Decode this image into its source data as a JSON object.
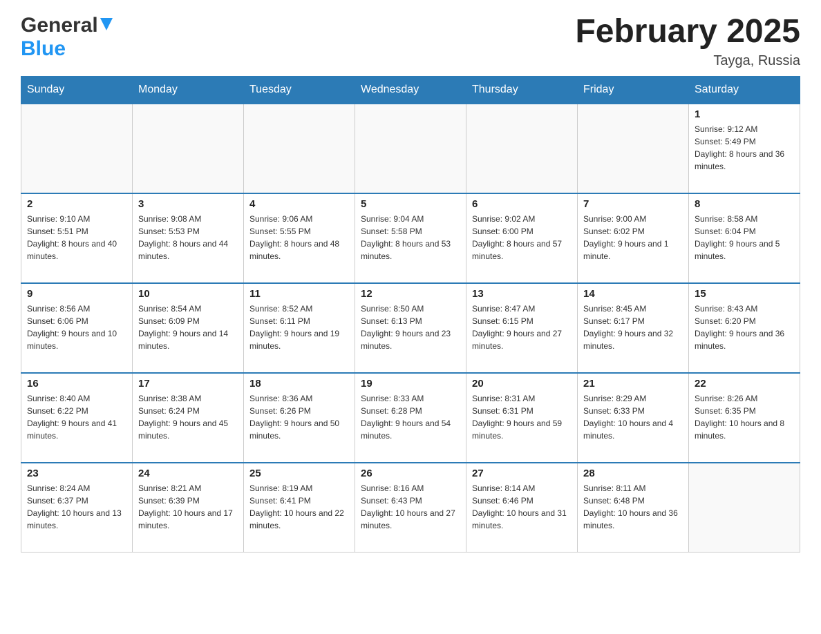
{
  "header": {
    "logo": {
      "general": "General",
      "blue": "Blue",
      "triangle_color": "#2196F3"
    },
    "title": "February 2025",
    "location": "Tayga, Russia"
  },
  "calendar": {
    "days_of_week": [
      "Sunday",
      "Monday",
      "Tuesday",
      "Wednesday",
      "Thursday",
      "Friday",
      "Saturday"
    ],
    "header_color": "#2c7bb6",
    "weeks": [
      {
        "days": [
          {
            "date": "",
            "info": ""
          },
          {
            "date": "",
            "info": ""
          },
          {
            "date": "",
            "info": ""
          },
          {
            "date": "",
            "info": ""
          },
          {
            "date": "",
            "info": ""
          },
          {
            "date": "",
            "info": ""
          },
          {
            "date": "1",
            "info": "Sunrise: 9:12 AM\nSunset: 5:49 PM\nDaylight: 8 hours and 36 minutes."
          }
        ]
      },
      {
        "days": [
          {
            "date": "2",
            "info": "Sunrise: 9:10 AM\nSunset: 5:51 PM\nDaylight: 8 hours and 40 minutes."
          },
          {
            "date": "3",
            "info": "Sunrise: 9:08 AM\nSunset: 5:53 PM\nDaylight: 8 hours and 44 minutes."
          },
          {
            "date": "4",
            "info": "Sunrise: 9:06 AM\nSunset: 5:55 PM\nDaylight: 8 hours and 48 minutes."
          },
          {
            "date": "5",
            "info": "Sunrise: 9:04 AM\nSunset: 5:58 PM\nDaylight: 8 hours and 53 minutes."
          },
          {
            "date": "6",
            "info": "Sunrise: 9:02 AM\nSunset: 6:00 PM\nDaylight: 8 hours and 57 minutes."
          },
          {
            "date": "7",
            "info": "Sunrise: 9:00 AM\nSunset: 6:02 PM\nDaylight: 9 hours and 1 minute."
          },
          {
            "date": "8",
            "info": "Sunrise: 8:58 AM\nSunset: 6:04 PM\nDaylight: 9 hours and 5 minutes."
          }
        ]
      },
      {
        "days": [
          {
            "date": "9",
            "info": "Sunrise: 8:56 AM\nSunset: 6:06 PM\nDaylight: 9 hours and 10 minutes."
          },
          {
            "date": "10",
            "info": "Sunrise: 8:54 AM\nSunset: 6:09 PM\nDaylight: 9 hours and 14 minutes."
          },
          {
            "date": "11",
            "info": "Sunrise: 8:52 AM\nSunset: 6:11 PM\nDaylight: 9 hours and 19 minutes."
          },
          {
            "date": "12",
            "info": "Sunrise: 8:50 AM\nSunset: 6:13 PM\nDaylight: 9 hours and 23 minutes."
          },
          {
            "date": "13",
            "info": "Sunrise: 8:47 AM\nSunset: 6:15 PM\nDaylight: 9 hours and 27 minutes."
          },
          {
            "date": "14",
            "info": "Sunrise: 8:45 AM\nSunset: 6:17 PM\nDaylight: 9 hours and 32 minutes."
          },
          {
            "date": "15",
            "info": "Sunrise: 8:43 AM\nSunset: 6:20 PM\nDaylight: 9 hours and 36 minutes."
          }
        ]
      },
      {
        "days": [
          {
            "date": "16",
            "info": "Sunrise: 8:40 AM\nSunset: 6:22 PM\nDaylight: 9 hours and 41 minutes."
          },
          {
            "date": "17",
            "info": "Sunrise: 8:38 AM\nSunset: 6:24 PM\nDaylight: 9 hours and 45 minutes."
          },
          {
            "date": "18",
            "info": "Sunrise: 8:36 AM\nSunset: 6:26 PM\nDaylight: 9 hours and 50 minutes."
          },
          {
            "date": "19",
            "info": "Sunrise: 8:33 AM\nSunset: 6:28 PM\nDaylight: 9 hours and 54 minutes."
          },
          {
            "date": "20",
            "info": "Sunrise: 8:31 AM\nSunset: 6:31 PM\nDaylight: 9 hours and 59 minutes."
          },
          {
            "date": "21",
            "info": "Sunrise: 8:29 AM\nSunset: 6:33 PM\nDaylight: 10 hours and 4 minutes."
          },
          {
            "date": "22",
            "info": "Sunrise: 8:26 AM\nSunset: 6:35 PM\nDaylight: 10 hours and 8 minutes."
          }
        ]
      },
      {
        "days": [
          {
            "date": "23",
            "info": "Sunrise: 8:24 AM\nSunset: 6:37 PM\nDaylight: 10 hours and 13 minutes."
          },
          {
            "date": "24",
            "info": "Sunrise: 8:21 AM\nSunset: 6:39 PM\nDaylight: 10 hours and 17 minutes."
          },
          {
            "date": "25",
            "info": "Sunrise: 8:19 AM\nSunset: 6:41 PM\nDaylight: 10 hours and 22 minutes."
          },
          {
            "date": "26",
            "info": "Sunrise: 8:16 AM\nSunset: 6:43 PM\nDaylight: 10 hours and 27 minutes."
          },
          {
            "date": "27",
            "info": "Sunrise: 8:14 AM\nSunset: 6:46 PM\nDaylight: 10 hours and 31 minutes."
          },
          {
            "date": "28",
            "info": "Sunrise: 8:11 AM\nSunset: 6:48 PM\nDaylight: 10 hours and 36 minutes."
          },
          {
            "date": "",
            "info": ""
          }
        ]
      }
    ]
  }
}
